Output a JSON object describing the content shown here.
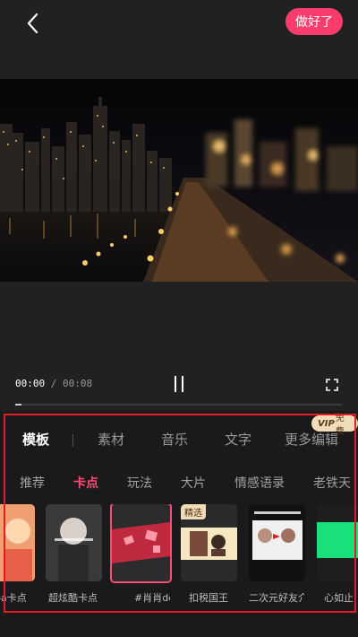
{
  "header": {
    "done_label": "做好了"
  },
  "player": {
    "current_time": "00:00",
    "total_time": "00:08",
    "separator": " / ",
    "progress": 0.02
  },
  "panel": {
    "tabs": [
      "模板",
      "素材",
      "音乐",
      "文字",
      "更多编辑"
    ],
    "vip_badge": {
      "vip": "VIP",
      "text": "免费"
    },
    "categories": [
      "推荐",
      "卡点",
      "玩法",
      "大片",
      "情感语录",
      "老铁天"
    ],
    "templates": [
      {
        "label": "pa卡点",
        "badge": ""
      },
      {
        "label": "超炫酷卡点",
        "badge": ""
      },
      {
        "label": "#肖肖de",
        "badge": ""
      },
      {
        "label": "扣税国王",
        "badge": "精选"
      },
      {
        "label": "二次元好友介",
        "badge": ""
      },
      {
        "label": "心如止",
        "badge": ""
      }
    ]
  },
  "colors": {
    "accent": "#ff3d6d",
    "active_category": "#ff4d76",
    "highlight": "#e21c24"
  }
}
